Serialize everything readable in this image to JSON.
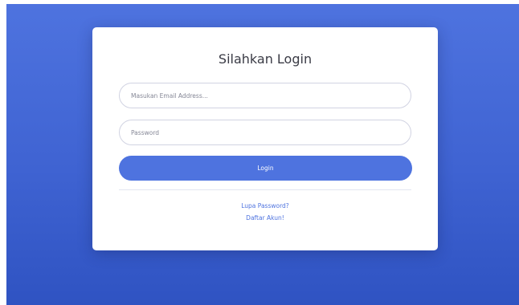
{
  "login": {
    "title": "Silahkan Login",
    "email_placeholder": "Masukan Email Address...",
    "password_placeholder": "Password",
    "login_button": "Login",
    "forgot_password_link": "Lupa Password?",
    "register_link": "Daftar Akun!"
  },
  "colors": {
    "background_start": "#4e73df",
    "background_end": "#2f53c2",
    "primary_button": "#4e73df",
    "link": "#4e73df",
    "card": "#ffffff"
  }
}
